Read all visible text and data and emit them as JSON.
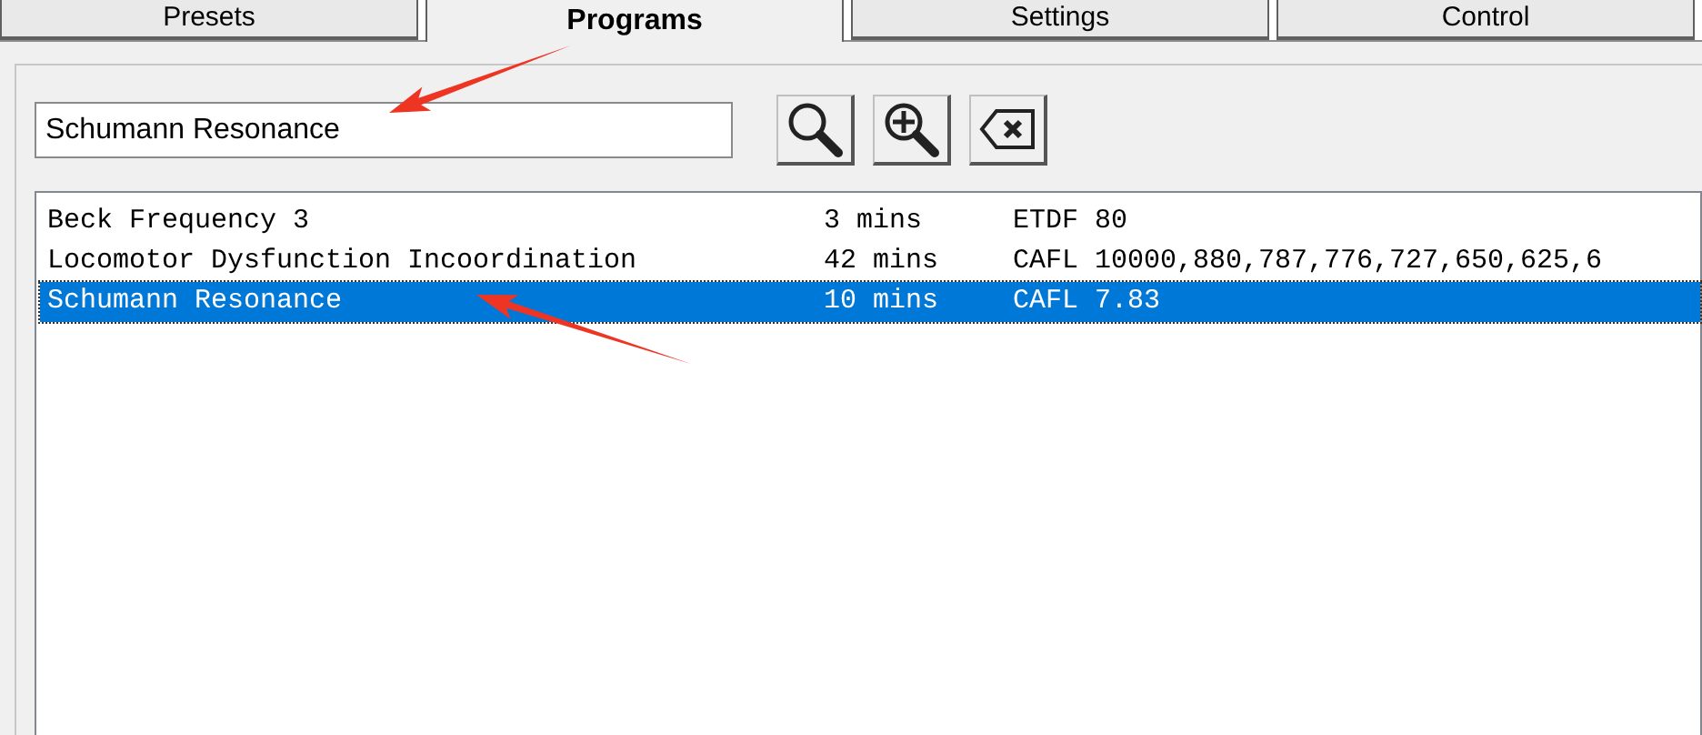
{
  "tabs": [
    {
      "label": "Presets",
      "selected": false
    },
    {
      "label": "Programs",
      "selected": true
    },
    {
      "label": "Settings",
      "selected": false
    },
    {
      "label": "Control",
      "selected": false
    }
  ],
  "search": {
    "value": "Schumann Resonance"
  },
  "programs": [
    {
      "name": "Beck Frequency 3",
      "duration": "3 mins",
      "frequencies": "ETDF 80",
      "selected": false
    },
    {
      "name": "Locomotor Dysfunction Incoordination",
      "duration": "42 mins",
      "frequencies": "CAFL 10000,880,787,776,727,650,625,6",
      "selected": false
    },
    {
      "name": "Schumann Resonance",
      "duration": "10 mins",
      "frequencies": "CAFL 7.83",
      "selected": true
    }
  ]
}
